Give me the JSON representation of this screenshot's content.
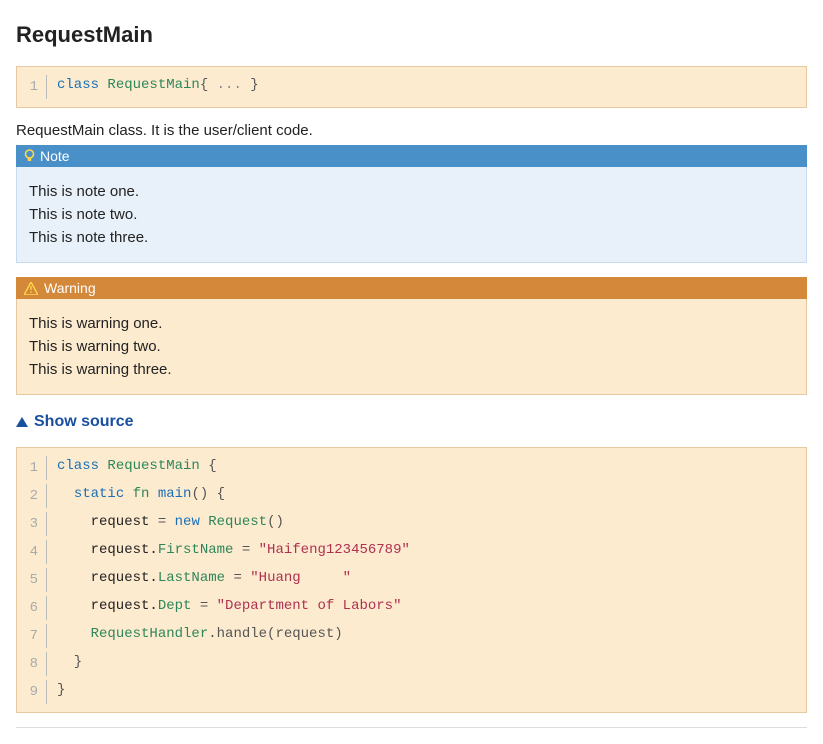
{
  "title": "RequestMain",
  "declaration": {
    "tokens": [
      {
        "t": "class ",
        "c": "kw"
      },
      {
        "t": "RequestMain",
        "c": "type"
      },
      {
        "t": "{ ",
        "c": "punct"
      },
      {
        "t": "...",
        "c": "comment"
      },
      {
        "t": " }",
        "c": "punct"
      }
    ]
  },
  "description": "RequestMain class. It is the user/client code.",
  "note": {
    "label": "Note",
    "items": [
      "This is note one.",
      "This is note two.",
      "This is note three."
    ]
  },
  "warning": {
    "label": "Warning",
    "items": [
      "This is warning one.",
      "This is warning two.",
      "This is warning three."
    ]
  },
  "show_source_label": "Show source",
  "source": {
    "lines": [
      [
        {
          "t": "class ",
          "c": "kw"
        },
        {
          "t": "RequestMain ",
          "c": "type"
        },
        {
          "t": "{",
          "c": "punct"
        }
      ],
      [
        {
          "t": "  ",
          "c": ""
        },
        {
          "t": "static ",
          "c": "kw"
        },
        {
          "t": "fn ",
          "c": "prop"
        },
        {
          "t": "main",
          "c": "kw"
        },
        {
          "t": "() {",
          "c": "punct"
        }
      ],
      [
        {
          "t": "    request ",
          "c": ""
        },
        {
          "t": "=",
          "c": "punct"
        },
        {
          "t": " ",
          "c": ""
        },
        {
          "t": "new ",
          "c": "kw"
        },
        {
          "t": "Request",
          "c": "type"
        },
        {
          "t": "()",
          "c": "punct"
        }
      ],
      [
        {
          "t": "    request.",
          "c": ""
        },
        {
          "t": "FirstName ",
          "c": "prop"
        },
        {
          "t": "=",
          "c": "punct"
        },
        {
          "t": " ",
          "c": ""
        },
        {
          "t": "\"Haifeng123456789\"",
          "c": "str"
        }
      ],
      [
        {
          "t": "    request.",
          "c": ""
        },
        {
          "t": "LastName ",
          "c": "prop"
        },
        {
          "t": "=",
          "c": "punct"
        },
        {
          "t": " ",
          "c": ""
        },
        {
          "t": "\"Huang     \"",
          "c": "str"
        }
      ],
      [
        {
          "t": "    request.",
          "c": ""
        },
        {
          "t": "Dept ",
          "c": "prop"
        },
        {
          "t": "=",
          "c": "punct"
        },
        {
          "t": " ",
          "c": ""
        },
        {
          "t": "\"Department of Labors\"",
          "c": "str"
        }
      ],
      [
        {
          "t": "    ",
          "c": ""
        },
        {
          "t": "RequestHandler",
          "c": "type"
        },
        {
          "t": ".handle(request)",
          "c": "punct"
        }
      ],
      [
        {
          "t": "  }",
          "c": "punct"
        }
      ],
      [
        {
          "t": "}",
          "c": "punct"
        }
      ]
    ]
  }
}
